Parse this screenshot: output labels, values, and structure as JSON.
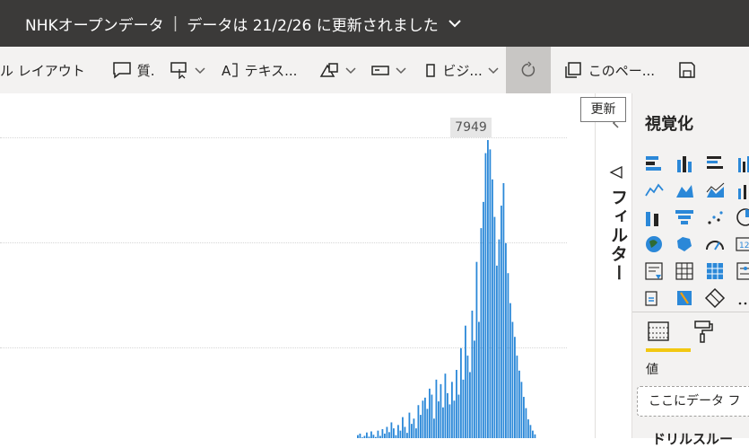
{
  "title_bar": {
    "report_name": "NHKオープンデータ",
    "separator": "|",
    "refresh_info": "データは 21/2/26 に更新されました"
  },
  "ribbon": {
    "layout_label": "ル レイアウト",
    "qa_label": "質.",
    "textbox_label": "テキス...",
    "visual_label": "ビジ...",
    "page_label": "このペー..."
  },
  "refresh_tooltip": "更新",
  "chart_data": {
    "type": "bar",
    "peak_label": "7949",
    "peak_value": 7949,
    "values": [
      80,
      120,
      20,
      60,
      150,
      40,
      180,
      90,
      30,
      200,
      60,
      240,
      120,
      300,
      160,
      420,
      260,
      80,
      350,
      200,
      560,
      300,
      140,
      680,
      380,
      520,
      260,
      880,
      620,
      1000,
      1080,
      780,
      1320,
      1160,
      520,
      1560,
      980,
      1440,
      820,
      1720,
      1200,
      900,
      1500,
      1000,
      1820,
      1160,
      2400,
      1560,
      3000,
      2200,
      1760,
      3400,
      2600,
      4700,
      3100,
      5600,
      6300,
      7600,
      7949,
      7700,
      6900,
      5900,
      4600,
      5300,
      6200,
      6800,
      5200,
      4400,
      3600,
      3100,
      2700,
      2200,
      1800,
      1500,
      1100,
      800,
      500,
      350,
      200,
      100
    ]
  },
  "filters_label": "フィルター",
  "visualizations": {
    "title": "視覚化",
    "values_label": "値",
    "drop_placeholder": "ここにデータ フ",
    "cut_off_heading": "ドリルスルー"
  },
  "colors": {
    "bar": "#2b88d8",
    "accent_yellow": "#f2c811",
    "titlebar": "#3b3a39"
  }
}
